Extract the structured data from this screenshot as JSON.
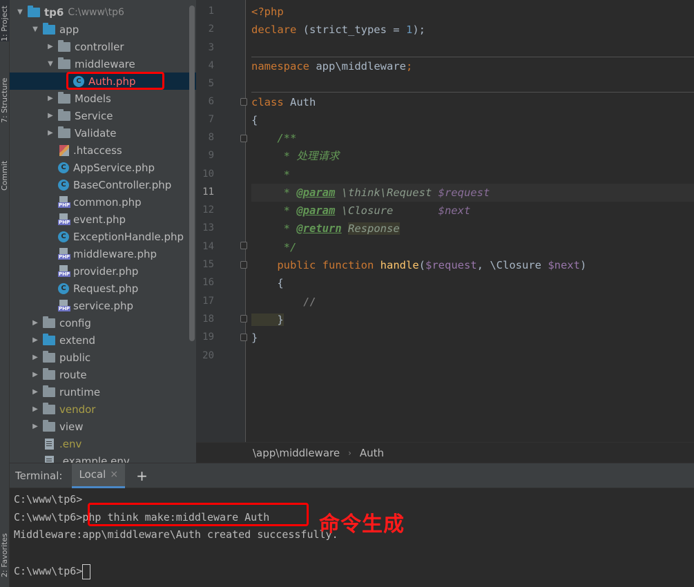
{
  "tool_windows": {
    "project_tab": "1: Project",
    "structure_tab": "7: Structure",
    "commit_tab": "Commit",
    "favorites_tab": "2: Favorites"
  },
  "project_tree": [
    {
      "label": "tp6",
      "path": "C:\\www\\tp6",
      "depth": 0,
      "kind": "folder-blue",
      "arrow": "▼"
    },
    {
      "label": "app",
      "depth": 1,
      "kind": "folder-blue",
      "arrow": "▼"
    },
    {
      "label": "controller",
      "depth": 2,
      "kind": "folder",
      "arrow": "▶"
    },
    {
      "label": "middleware",
      "depth": 2,
      "kind": "folder",
      "arrow": "▼"
    },
    {
      "label": "Auth.php",
      "depth": 3,
      "kind": "class",
      "selected": true
    },
    {
      "label": "Models",
      "depth": 2,
      "kind": "folder",
      "arrow": "▶"
    },
    {
      "label": "Service",
      "depth": 2,
      "kind": "folder",
      "arrow": "▶"
    },
    {
      "label": "Validate",
      "depth": 2,
      "kind": "folder",
      "arrow": "▶"
    },
    {
      "label": ".htaccess",
      "depth": 2,
      "kind": "htaccess"
    },
    {
      "label": "AppService.php",
      "depth": 2,
      "kind": "class"
    },
    {
      "label": "BaseController.php",
      "depth": 2,
      "kind": "class"
    },
    {
      "label": "common.php",
      "depth": 2,
      "kind": "php"
    },
    {
      "label": "event.php",
      "depth": 2,
      "kind": "php"
    },
    {
      "label": "ExceptionHandle.php",
      "depth": 2,
      "kind": "class"
    },
    {
      "label": "middleware.php",
      "depth": 2,
      "kind": "php"
    },
    {
      "label": "provider.php",
      "depth": 2,
      "kind": "php"
    },
    {
      "label": "Request.php",
      "depth": 2,
      "kind": "class"
    },
    {
      "label": "service.php",
      "depth": 2,
      "kind": "php"
    },
    {
      "label": "config",
      "depth": 1,
      "kind": "folder",
      "arrow": "▶"
    },
    {
      "label": "extend",
      "depth": 1,
      "kind": "folder-blue",
      "arrow": "▶"
    },
    {
      "label": "public",
      "depth": 1,
      "kind": "folder",
      "arrow": "▶"
    },
    {
      "label": "route",
      "depth": 1,
      "kind": "folder",
      "arrow": "▶"
    },
    {
      "label": "runtime",
      "depth": 1,
      "kind": "folder",
      "arrow": "▶"
    },
    {
      "label": "vendor",
      "depth": 1,
      "kind": "folder-vendor",
      "arrow": "▶"
    },
    {
      "label": "view",
      "depth": 1,
      "kind": "folder",
      "arrow": "▶"
    },
    {
      "label": ".env",
      "depth": 1,
      "kind": "env"
    },
    {
      "label": ".example.env",
      "depth": 1,
      "kind": "file"
    }
  ],
  "editor": {
    "line_numbers": [
      "1",
      "2",
      "3",
      "4",
      "5",
      "6",
      "7",
      "8",
      "9",
      "10",
      "11",
      "12",
      "13",
      "14",
      "15",
      "16",
      "17",
      "18",
      "19",
      "20"
    ],
    "current_line": "11",
    "code": {
      "l1": "<?php",
      "l2_kw": "declare",
      "l2_rest": " (strict_types = ",
      "l2_num": "1",
      "l2_end": ");",
      "l4_kw": "namespace",
      "l4_ns": " app\\middleware",
      "l4_end": ";",
      "l6_kw": "class",
      "l6_name": " Auth",
      "l7": "{",
      "l8": "    /**",
      "l9": "     * 处理请求",
      "l10": "     *",
      "l11_pre": "     * ",
      "l11_tag": "@param",
      "l11_type": " \\think\\Request ",
      "l11_var": "$request",
      "l12_pre": "     * ",
      "l12_tag": "@param",
      "l12_type": " \\Closure       ",
      "l12_var": "$next",
      "l13_pre": "     * ",
      "l13_tag": "@return",
      "l13_type": "Response",
      "l14": "     */",
      "l15_kw1": "    public",
      "l15_kw2": " function",
      "l15_fn": " handle",
      "l15_p1": "(",
      "l15_v1": "$request",
      "l15_sep": ", \\Closure ",
      "l15_v2": "$next",
      "l15_end": ")",
      "l16": "    {",
      "l17": "        //",
      "l18": "    }",
      "l19": "}"
    }
  },
  "breadcrumb": {
    "path": "\\app\\middleware",
    "separator": "›",
    "item": "Auth"
  },
  "terminal": {
    "title": "Terminal:",
    "tab_label": "Local",
    "close_glyph": "×",
    "add_glyph": "+",
    "lines": [
      "C:\\www\\tp6>",
      "C:\\www\\tp6>php think make:middleware Auth",
      "Middleware:app\\middleware\\Auth created successfully.",
      "",
      "C:\\www\\tp6>"
    ]
  },
  "annotation": "命令生成",
  "colors": {
    "highlight_box": "#ff0000",
    "keyword": "#cc7832",
    "doc_comment": "#629755",
    "variable": "#9876aa",
    "function": "#ffc66d"
  }
}
